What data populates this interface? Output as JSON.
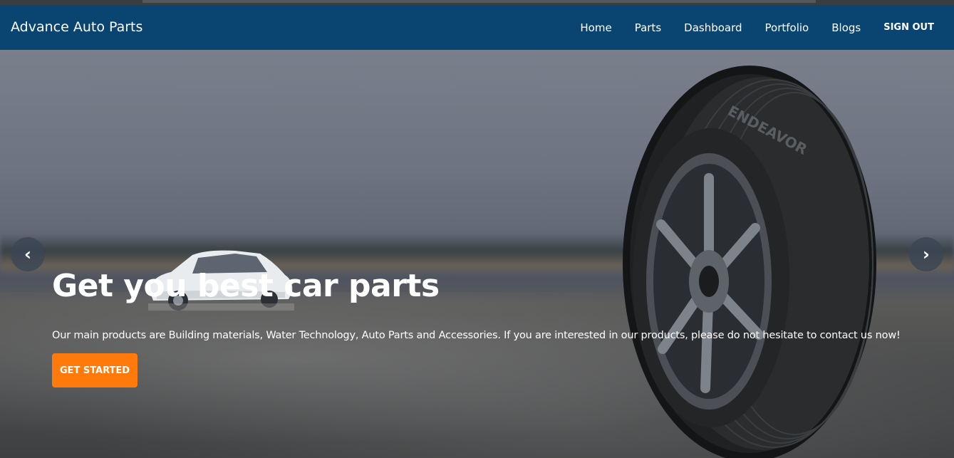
{
  "navbar": {
    "brand": "Advance Auto Parts",
    "links": [
      "Home",
      "Parts",
      "Dashboard",
      "Portfolio",
      "Blogs"
    ],
    "signout": "SIGN OUT"
  },
  "hero": {
    "headline": "Get you best car parts",
    "description": "Our main products are Building materials, Water Technology, Auto Parts and Accessories. If you are interested in our products, please do not hesitate to contact us now!",
    "cta_label": "GET STARTED",
    "prev_icon": "‹",
    "next_icon": "›",
    "tire_brand_text": "ENDEAVOR"
  },
  "colors": {
    "navbar_bg": "#0a4470",
    "cta_bg": "#ff7a0a"
  }
}
